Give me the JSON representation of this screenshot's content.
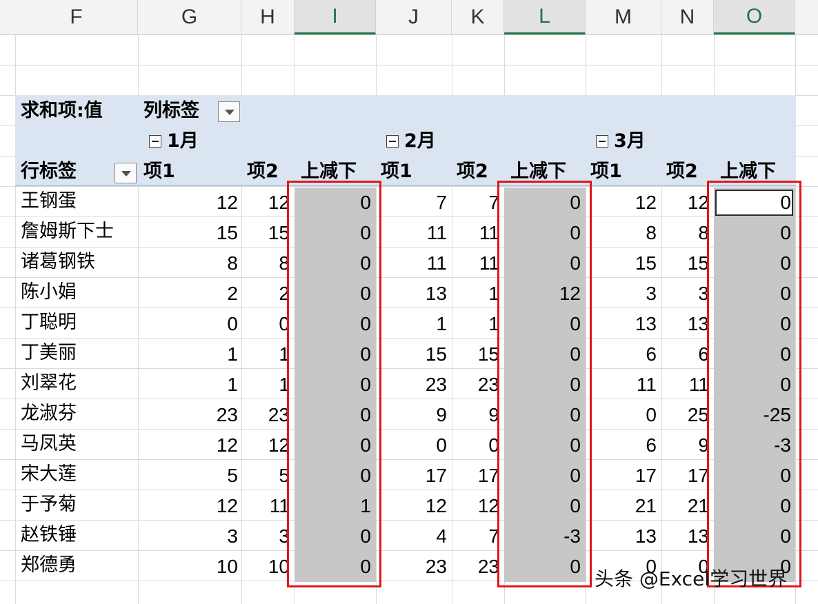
{
  "columns": [
    "F",
    "G",
    "H",
    "I",
    "J",
    "K",
    "L",
    "M",
    "N",
    "O"
  ],
  "pivot": {
    "value_label": "求和项:值",
    "col_label": "列标签",
    "row_label": "行标签",
    "months": [
      "1月",
      "2月",
      "3月"
    ],
    "sub_headers": [
      "项1",
      "项2",
      "上减下"
    ],
    "rows": [
      {
        "name": "王钢蛋",
        "v": [
          "12",
          "12",
          "0",
          "7",
          "7",
          "0",
          "12",
          "12",
          "0"
        ]
      },
      {
        "name": "詹姆斯下士",
        "v": [
          "15",
          "15",
          "0",
          "11",
          "11",
          "0",
          "8",
          "8",
          "0"
        ]
      },
      {
        "name": "诸葛钢铁",
        "v": [
          "8",
          "8",
          "0",
          "11",
          "11",
          "0",
          "15",
          "15",
          "0"
        ]
      },
      {
        "name": "陈小娟",
        "v": [
          "2",
          "2",
          "0",
          "13",
          "1",
          "12",
          "3",
          "3",
          "0"
        ]
      },
      {
        "name": "丁聪明",
        "v": [
          "0",
          "0",
          "0",
          "1",
          "1",
          "0",
          "13",
          "13",
          "0"
        ]
      },
      {
        "name": "丁美丽",
        "v": [
          "1",
          "1",
          "0",
          "15",
          "15",
          "0",
          "6",
          "6",
          "0"
        ]
      },
      {
        "name": "刘翠花",
        "v": [
          "1",
          "1",
          "0",
          "23",
          "23",
          "0",
          "11",
          "11",
          "0"
        ]
      },
      {
        "name": "龙淑芬",
        "v": [
          "23",
          "23",
          "0",
          "9",
          "9",
          "0",
          "0",
          "25",
          "-25"
        ]
      },
      {
        "name": "马凤英",
        "v": [
          "12",
          "12",
          "0",
          "0",
          "0",
          "0",
          "6",
          "9",
          "-3"
        ]
      },
      {
        "name": "宋大莲",
        "v": [
          "5",
          "5",
          "0",
          "17",
          "17",
          "0",
          "17",
          "17",
          "0"
        ]
      },
      {
        "name": "于予菊",
        "v": [
          "12",
          "11",
          "1",
          "12",
          "12",
          "0",
          "21",
          "21",
          "0"
        ]
      },
      {
        "name": "赵铁锤",
        "v": [
          "3",
          "3",
          "0",
          "4",
          "7",
          "-3",
          "13",
          "13",
          "0"
        ]
      },
      {
        "name": "郑德勇",
        "v": [
          "10",
          "10",
          "0",
          "23",
          "23",
          "0",
          "0",
          "0",
          "0"
        ]
      }
    ]
  },
  "watermark": "头条 @Excel学习世界",
  "colors": {
    "highlight_border": "#e0161b",
    "pivot_header": "#dbe5f1",
    "selected_fill": "#c7c7c7"
  }
}
